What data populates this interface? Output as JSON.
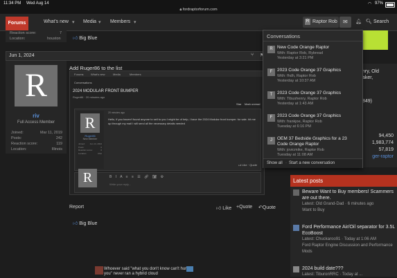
{
  "statusbar": {
    "time": "11:34 PM",
    "date": "Wed Aug 14",
    "battery": "97%"
  },
  "urlbar": {
    "url": "fordraptorforum.com"
  },
  "nav": {
    "forums": "Forums",
    "whats_new": "What's new",
    "media": "Media",
    "members": "Members",
    "user": "Raptor Rob",
    "search": "Search"
  },
  "top_profile": {
    "reaction_label": "Reaction score:",
    "reaction_value": "7",
    "location_label": "Location:",
    "location_value": "houston",
    "reaction": "Big Blue"
  },
  "post": {
    "date": "Jun 1, 2024",
    "title": "Add Ruger86 to the list",
    "embedded": {
      "breadcrumb": [
        "Forums",
        "What's new",
        "Media",
        "Members"
      ],
      "conversations_label": "Conversations",
      "conv_title": "2024 MODULAR FRONT BUMPER",
      "conv_meta1": "Ruger86",
      "conv_meta2": "20 minutes ago",
      "star": "Star",
      "mark_unread": "Mark unread",
      "msg_time": "20 minutes ago",
      "msg_text": "Hello, if you haven't found anyone to sell to you I might be of help, I have the 2024 Modular front bumper. for sale. hit me up through my mail I will send all the necessary details needed",
      "user_name": "Ruger86",
      "user_role": "New Member",
      "user_stats": [
        {
          "k": "Joined:",
          "v": "Jun 14, 2024"
        },
        {
          "k": "Posts:",
          "v": "0"
        },
        {
          "k": "Reaction score:",
          "v": "0"
        },
        {
          "k": "Location:",
          "v": "USA"
        }
      ],
      "like": "Like",
      "quote": "Quote",
      "reply_placeholder": "Write your reply..."
    },
    "report": "Report",
    "like": "Like",
    "quote_small": "+Quote",
    "quote": "Quote",
    "reaction": "Big Blue"
  },
  "author": {
    "initial": "R",
    "name": "riv",
    "role": "Full Access Member",
    "stats": [
      {
        "k": "Joined:",
        "v": "Mar 11, 2019"
      },
      {
        "k": "Posts:",
        "v": "242"
      },
      {
        "k": "Reaction score:",
        "v": "119"
      },
      {
        "k": "Location:",
        "v": "Illinois"
      }
    ]
  },
  "reply_avatar": "R",
  "conversations": {
    "header": "Conversations",
    "items": [
      {
        "icon": "R",
        "title": "New Code Orange Raptor",
        "with": "With: Raptor Rob, Rybread",
        "time": "Yesterday at 3:21 PM"
      },
      {
        "icon": "F",
        "title": "2023 Code Orange 37 Graphics",
        "with": "With: fhdh, Raptor Rob",
        "time": "Yesterday at 10:37 AM"
      },
      {
        "icon": "T",
        "title": "2023 Code Orange 37 Graphics",
        "with": "With: Tibushenry, Raptor Rob",
        "time": "Yesterday at 1:43 AM"
      },
      {
        "icon": "F",
        "title": "2023 Code Orange 37 Graphics",
        "with": "With: frankjoe, Raptor Rob",
        "time": "Tuesday at 6:16 PM"
      },
      {
        "icon": "J",
        "title": "OEM 37 Bedside Graphics for a 23 Code Orange Raptor",
        "with": "With: jovicmike, Raptor Rob",
        "time": "Tuesday at 11:08 AM"
      }
    ],
    "show_all": "Show all",
    "start_new": "Start a new conversation"
  },
  "sidebar": {
    "partial_text": [
      "nry, Old",
      "aker,",
      "849)"
    ],
    "stats": [
      "94,450",
      "1,983,774",
      "57,819",
      "ger-raptor"
    ],
    "latest_header": "Latest posts",
    "latest": [
      {
        "title": "Beware Want to Buy members! Scammers are out there.",
        "meta": "Latest: Old Grand-Dad · 6 minutes ago",
        "forum": "Want to Buy"
      },
      {
        "title": "Ford Performance Air/Oil separator for 3.5L EcoBoost",
        "meta": "Latest: Chuckaroo91 · Today at 1:06 AM",
        "forum": "Ford Raptor Engine Discussion and Performance Mods"
      },
      {
        "title": "2024 build date???",
        "meta": "Latest: TiburonRRC · Today at ...",
        "forum": ""
      }
    ]
  },
  "signature": {
    "text": "Whoever said \"what you don't know can't hurt you\" never ran a hybrid cloud"
  },
  "colors": {
    "accent": "#c0392b",
    "link": "#5a8fd8",
    "bg": "#1d1d1d"
  }
}
